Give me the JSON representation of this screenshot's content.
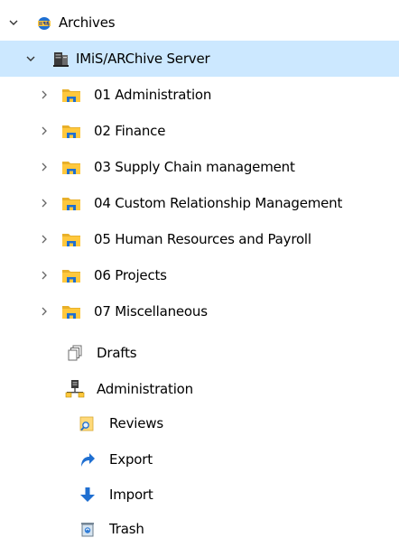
{
  "tree": {
    "root": {
      "label": "Archives",
      "icon": "imis-archive-icon",
      "expanded": true
    },
    "server": {
      "label": "IMiS/ARChive Server",
      "icon": "server-icon",
      "expanded": true
    },
    "folders": [
      {
        "label": "01 Administration",
        "icon": "folder-icon"
      },
      {
        "label": "02 Finance",
        "icon": "folder-icon"
      },
      {
        "label": "03 Supply Chain management",
        "icon": "folder-icon"
      },
      {
        "label": "04 Custom Relationship Management",
        "icon": "folder-icon"
      },
      {
        "label": "05 Human Resources and Payroll",
        "icon": "folder-icon"
      },
      {
        "label": "06 Projects",
        "icon": "folder-icon"
      },
      {
        "label": "07 Miscellaneous",
        "icon": "folder-icon"
      }
    ],
    "drafts": {
      "label": "Drafts",
      "icon": "drafts-icon"
    },
    "administration": {
      "label": "Administration",
      "icon": "administration-icon"
    },
    "admin_children": [
      {
        "label": "Reviews",
        "icon": "reviews-icon"
      },
      {
        "label": "Export",
        "icon": "export-icon"
      },
      {
        "label": "Import",
        "icon": "import-icon"
      },
      {
        "label": "Trash",
        "icon": "trash-icon"
      }
    ]
  },
  "colors": {
    "selected_row": "#cce8ff",
    "folder_yellow": "#ffc83d",
    "folder_blue": "#1f6fd1",
    "chevron": "#555555"
  }
}
